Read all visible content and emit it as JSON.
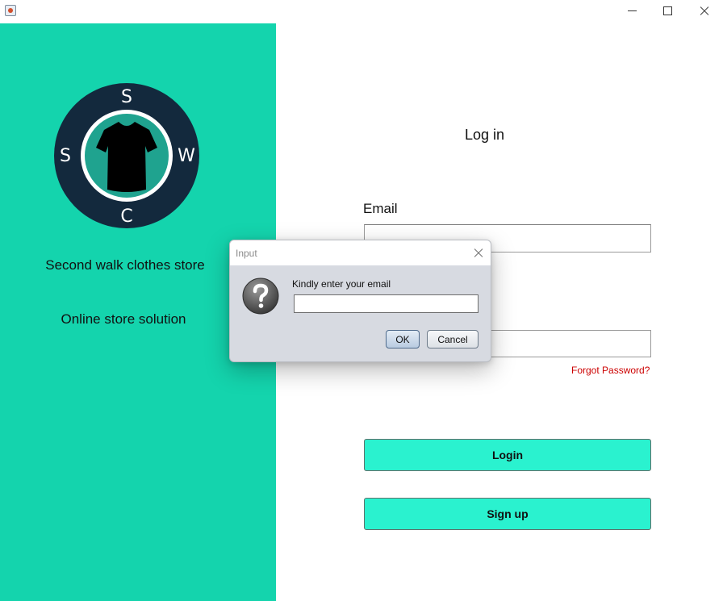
{
  "window": {
    "title": "",
    "controls": {
      "minimize": "minimize-icon",
      "maximize": "maximize-icon",
      "close": "close-icon"
    }
  },
  "brand": {
    "logo_letters": {
      "top": "S",
      "left": "S",
      "right": "W",
      "bottom": "C"
    },
    "name": "Second walk clothes store",
    "tagline": "Online store solution",
    "colors": {
      "panel": "#14d4ad",
      "logo_ring": "#13293d",
      "logo_inner": "#1fa38f"
    }
  },
  "form": {
    "title": "Log in",
    "email_label": "Email",
    "email_value": "",
    "password_value": "",
    "forgot_password": "Forgot Password?",
    "login_button": "Login",
    "signup_button": "Sign up",
    "button_color": "#2af2cf",
    "forgot_color": "#cc0000"
  },
  "dialog": {
    "title": "Input",
    "icon": "question-icon",
    "message": "Kindly enter your email",
    "input_value": "",
    "ok_button": "OK",
    "cancel_button": "Cancel"
  }
}
